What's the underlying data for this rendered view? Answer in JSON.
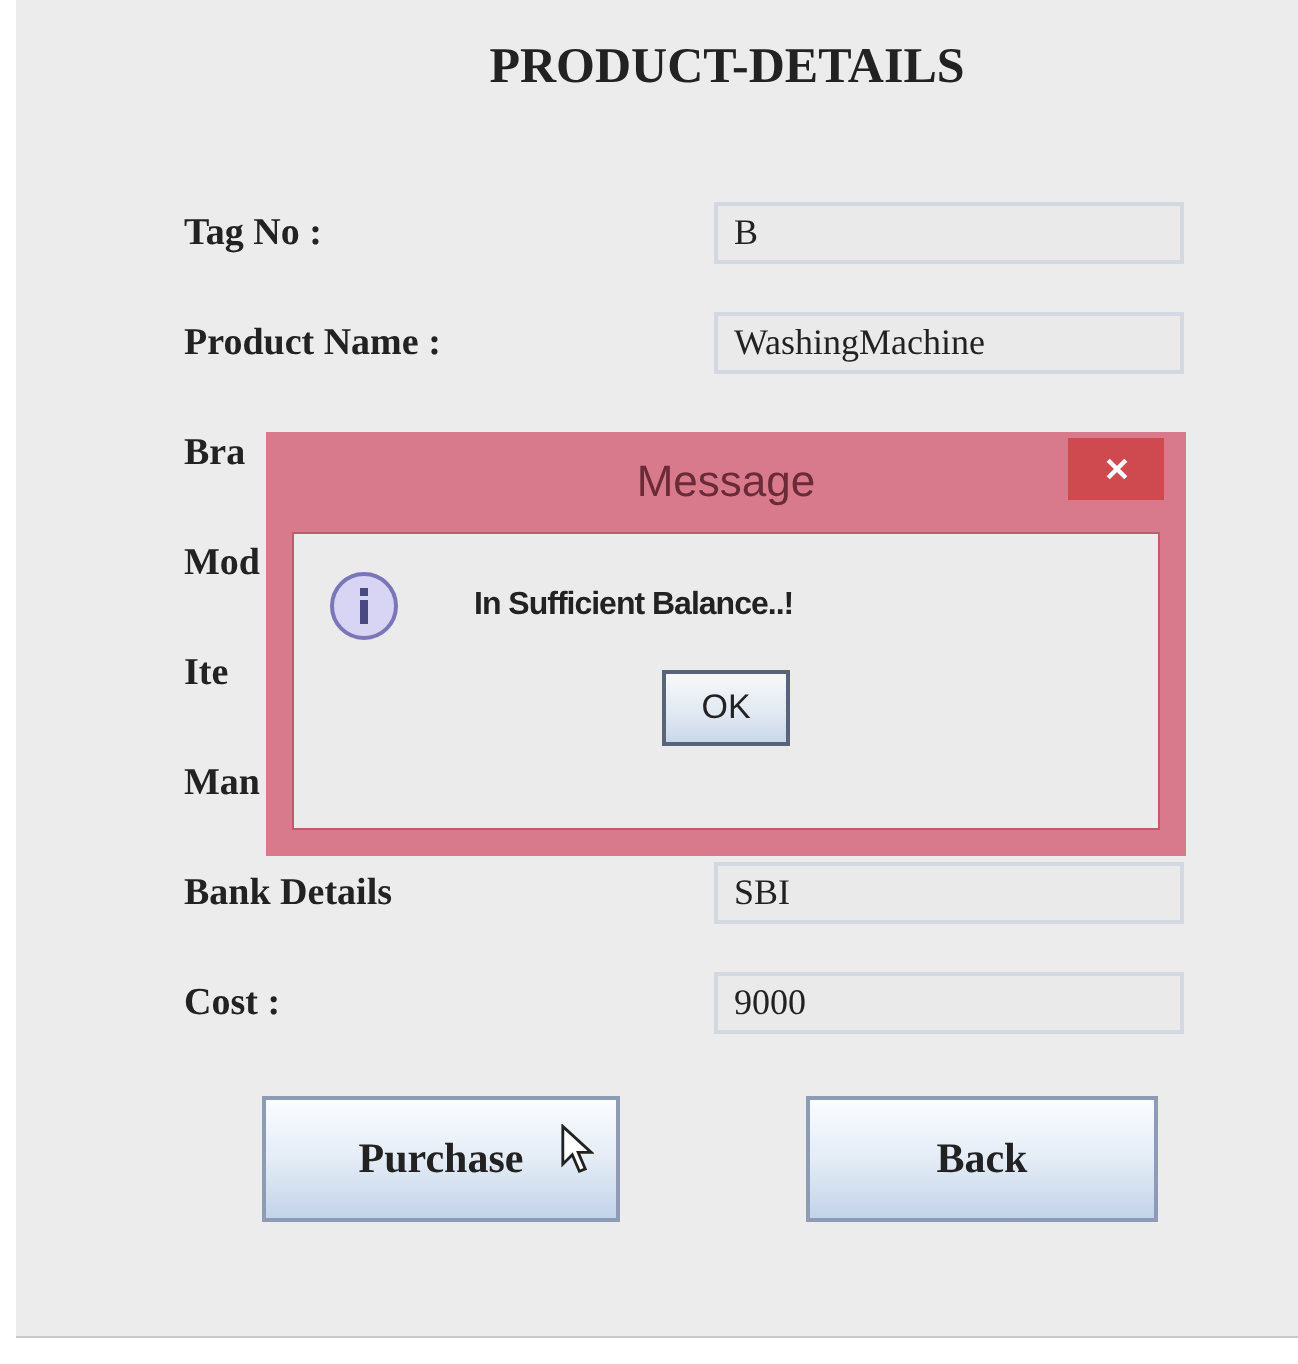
{
  "title": "PRODUCT-DETAILS",
  "rows": [
    {
      "label": "Tag No :",
      "value": "B"
    },
    {
      "label": "Product Name :",
      "value": "WashingMachine"
    },
    {
      "label": "Bra"
    },
    {
      "label": "Mod"
    },
    {
      "label": "Ite"
    },
    {
      "label": "Man"
    },
    {
      "label": "Bank Details",
      "value": "SBI"
    },
    {
      "label": "Cost :",
      "value": "9000"
    }
  ],
  "buttons": [
    "Purchase",
    "Back"
  ],
  "dialog": {
    "title": "Message",
    "message": "In Sufficient Balance..!",
    "button": "OK"
  }
}
